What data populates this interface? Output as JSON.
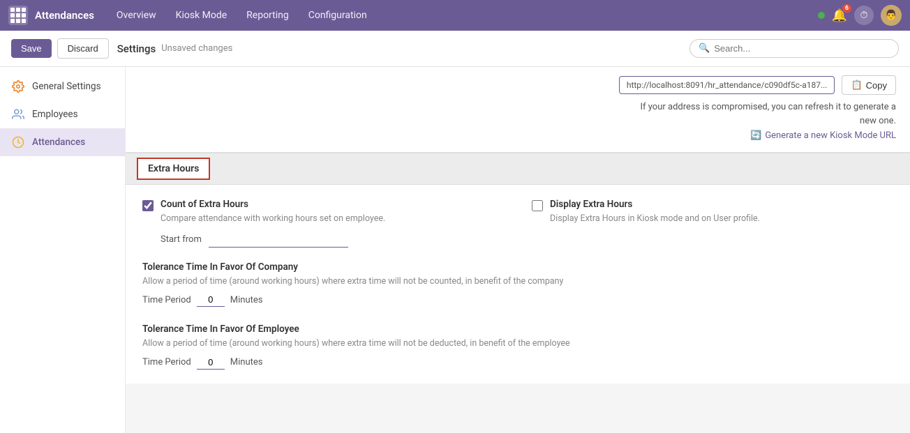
{
  "app": {
    "title": "Attendances",
    "nav_items": [
      "Overview",
      "Kiosk Mode",
      "Reporting",
      "Configuration"
    ]
  },
  "topnav": {
    "status": "online",
    "notif_count": "6",
    "avatar_emoji": "👨"
  },
  "toolbar": {
    "save_label": "Save",
    "discard_label": "Discard",
    "settings_label": "Settings",
    "unsaved_label": "Unsaved changes",
    "search_placeholder": "Search..."
  },
  "sidebar": {
    "items": [
      {
        "label": "General Settings",
        "icon": "gear",
        "active": false
      },
      {
        "label": "Employees",
        "icon": "people",
        "active": false
      },
      {
        "label": "Attendances",
        "icon": "clock",
        "active": true
      }
    ]
  },
  "kiosk": {
    "url": "http://localhost:8091/hr_attendance/c090df5c-a187...",
    "copy_label": "Copy",
    "warning_line1": "If your address is compromised, you can refresh it to generate a",
    "warning_line2": "new one.",
    "generate_label": "Generate a new Kiosk Mode URL"
  },
  "extra_hours": {
    "section_title": "Extra Hours",
    "count_label": "Count of Extra Hours",
    "count_desc": "Compare attendance with working hours set on employee.",
    "count_checked": true,
    "start_from_label": "Start from",
    "start_from_value": "",
    "display_label": "Display Extra Hours",
    "display_desc": "Display Extra Hours in Kiosk mode and on User profile.",
    "display_checked": false,
    "tolerance_company_title": "Tolerance Time In Favor Of Company",
    "tolerance_company_desc": "Allow a period of time (around working hours) where extra time will not be counted, in benefit of the company",
    "tolerance_company_period_label": "Time Period",
    "tolerance_company_value": "0",
    "tolerance_company_unit": "Minutes",
    "tolerance_employee_title": "Tolerance Time In Favor Of Employee",
    "tolerance_employee_desc": "Allow a period of time (around working hours) where extra time will not be deducted, in benefit of the employee",
    "tolerance_employee_period_label": "Time Period",
    "tolerance_employee_value": "0",
    "tolerance_employee_unit": "Minutes"
  }
}
